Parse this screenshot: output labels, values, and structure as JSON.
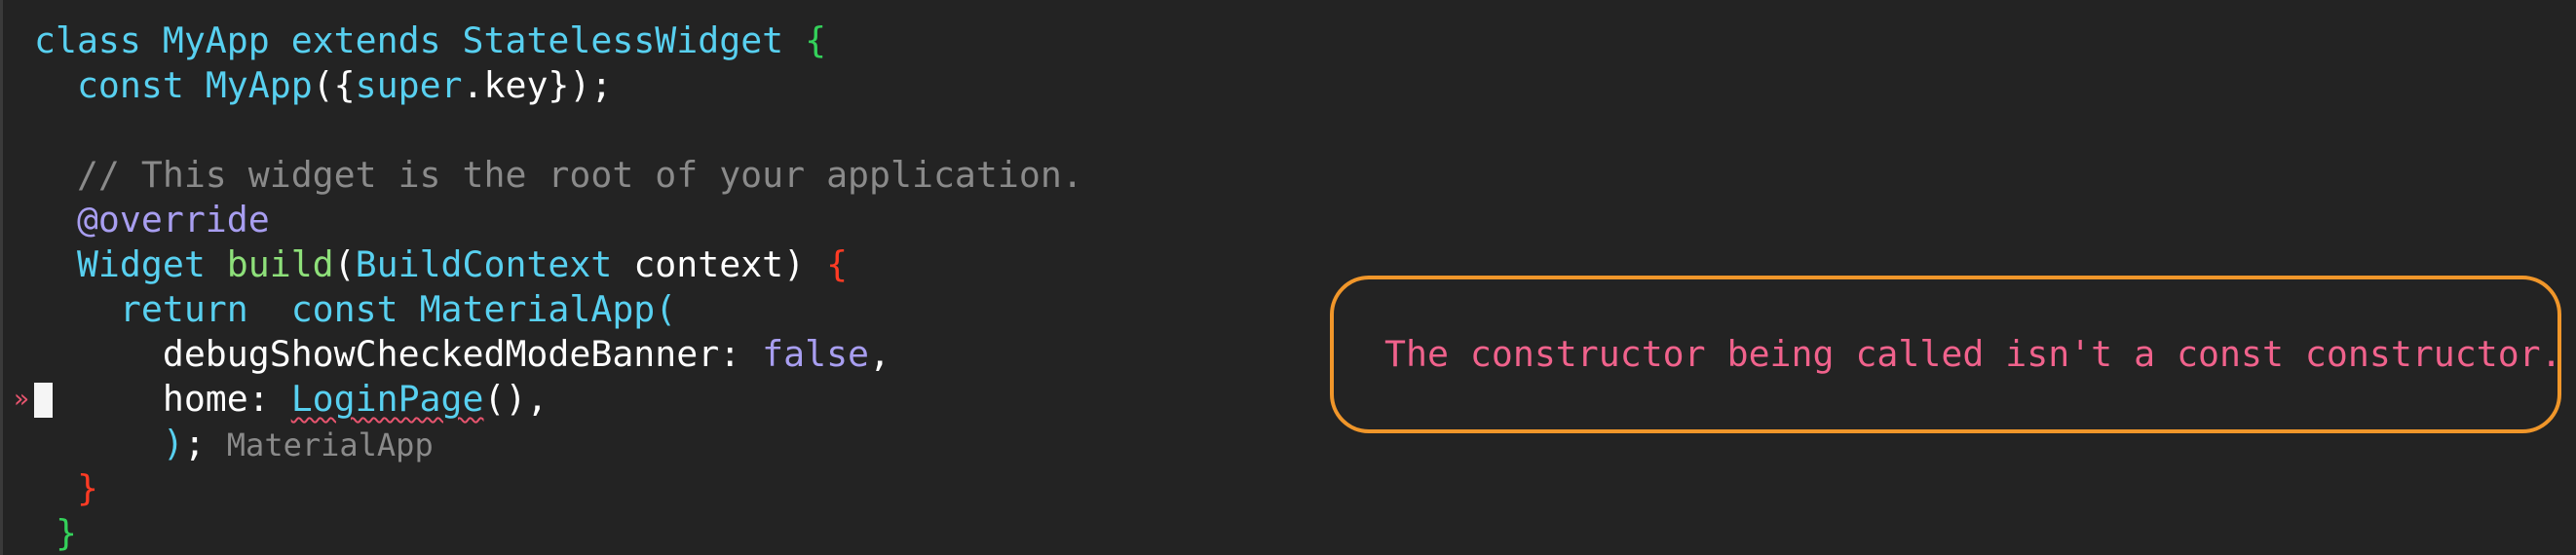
{
  "editor": {
    "lines": [
      {
        "tokens": [
          {
            "t": "class ",
            "c": "kw"
          },
          {
            "t": "MyApp ",
            "c": "ty"
          },
          {
            "t": "extends ",
            "c": "kw"
          },
          {
            "t": "StatelessWidget ",
            "c": "ty"
          },
          {
            "t": "{",
            "c": "b1"
          }
        ]
      },
      {
        "tokens": [
          {
            "t": "  const ",
            "c": "kw"
          },
          {
            "t": "MyApp",
            "c": "ty"
          },
          {
            "t": "({",
            "c": "plain"
          },
          {
            "t": "super",
            "c": "kw"
          },
          {
            "t": ".key});",
            "c": "plain"
          }
        ]
      },
      {
        "tokens": []
      },
      {
        "tokens": [
          {
            "t": "  // This widget is the root of your application.",
            "c": "cm"
          }
        ]
      },
      {
        "tokens": [
          {
            "t": "  @override",
            "c": "an"
          }
        ]
      },
      {
        "tokens": [
          {
            "t": "  Widget ",
            "c": "ty"
          },
          {
            "t": "build",
            "c": "fn"
          },
          {
            "t": "(",
            "c": "plain"
          },
          {
            "t": "BuildContext ",
            "c": "ty"
          },
          {
            "t": "context) ",
            "c": "plain"
          },
          {
            "t": "{",
            "c": "b2"
          }
        ]
      },
      {
        "tokens": [
          {
            "t": "    return  const ",
            "c": "kw"
          },
          {
            "t": "MaterialApp",
            "c": "ty"
          },
          {
            "t": "(",
            "c": "b3"
          }
        ]
      },
      {
        "tokens": [
          {
            "t": "      debugShowCheckedModeBanner: ",
            "c": "plain"
          },
          {
            "t": "false",
            "c": "bool"
          },
          {
            "t": ",",
            "c": "plain"
          }
        ]
      },
      {
        "tokens": [
          {
            "t": "      home: ",
            "c": "plain"
          },
          {
            "t": "LoginPage",
            "c": "err"
          },
          {
            "t": "(),",
            "c": "plain"
          }
        ],
        "marker": "»",
        "cursor": true
      },
      {
        "tokens": [
          {
            "t": "      )",
            "c": "b3"
          },
          {
            "t": "; ",
            "c": "plain"
          },
          {
            "t": "MaterialApp",
            "c": "hint"
          }
        ]
      },
      {
        "tokens": [
          {
            "t": "  }",
            "c": "b2"
          }
        ]
      },
      {
        "tokens": [
          {
            "t": " }",
            "c": "b1"
          }
        ]
      }
    ]
  },
  "diagnostic": {
    "message": "The constructor being called isn't a const constructor.",
    "border_color": "#f0962a",
    "text_color": "#f0628c"
  },
  "colors": {
    "background": "#232323",
    "keyword": "#58d0f0",
    "function": "#8ee07a",
    "comment": "#8a8a8a",
    "annotation": "#a89ef0",
    "error_underline": "#e8556f"
  }
}
